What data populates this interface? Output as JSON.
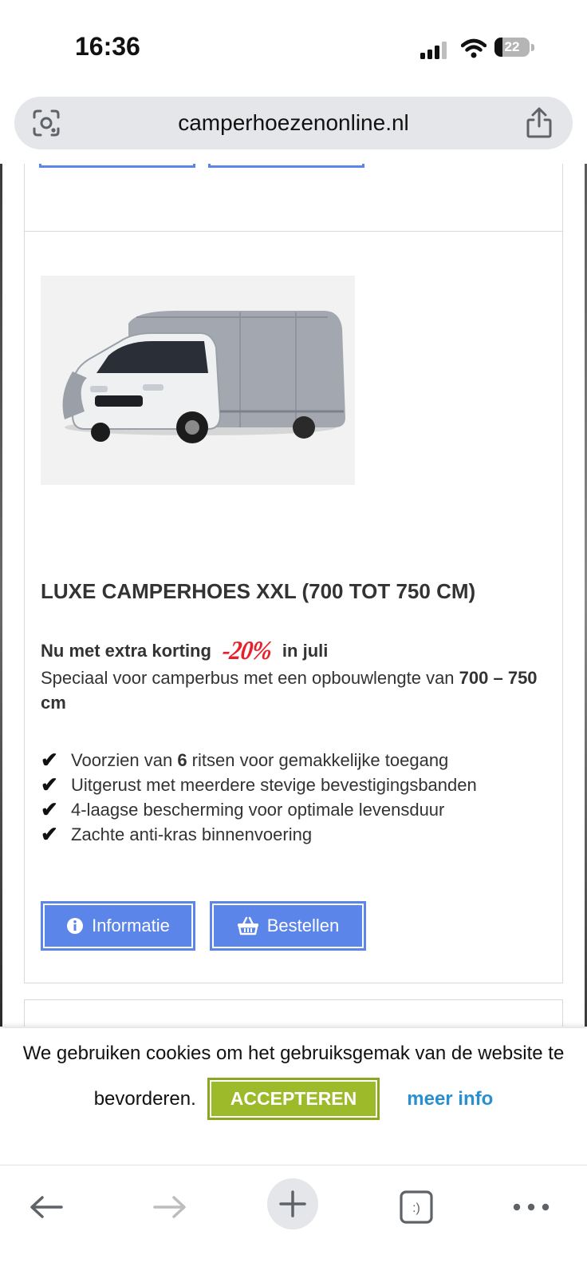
{
  "status": {
    "time": "16:36",
    "battery": "22",
    "battery_fraction": 0.22
  },
  "browser": {
    "url": "camperhoezenonline.nl"
  },
  "product": {
    "title": "LUXE CAMPERHOES XXL (700 TOT 750 CM)",
    "promo_prefix": "Nu met extra korting",
    "discount": "-20%",
    "promo_suffix": "in juli",
    "desc_text": "Speciaal voor camperbus met een opbouwlengte van ",
    "desc_bold": "700 – 750 cm",
    "features": [
      {
        "before": "Voorzien van ",
        "bold": "6",
        "after": " ritsen voor gemakkelijke toegang"
      },
      {
        "before": "Uitgerust met meerdere stevige bevestigingsbanden",
        "bold": "",
        "after": ""
      },
      {
        "before": "4-laagse bescherming voor optimale levensduur",
        "bold": "",
        "after": ""
      },
      {
        "before": "Zachte anti-kras binnenvoering",
        "bold": "",
        "after": ""
      }
    ],
    "check_glyph": "✔",
    "info_label": "Informatie",
    "order_label": "Bestellen"
  },
  "cookie": {
    "line1": "We gebruiken cookies om het gebruiksgemak van de website te",
    "line2": "bevorderen.",
    "accept_label": "ACCEPTEREN",
    "more_label": "meer info"
  },
  "nav": {
    "tabs_glyph": ":)"
  },
  "colors": {
    "button_blue": "#5b85e8",
    "accept_green": "#9cba2a",
    "link_blue": "#2a8fd0",
    "discount_red": "#e8202a"
  }
}
